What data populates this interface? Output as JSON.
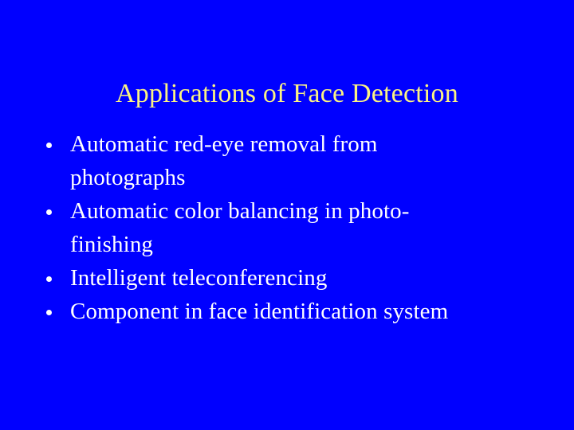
{
  "slide": {
    "background_color": "#0000FF",
    "title": {
      "text": "Applications of Face Detection",
      "color": "#FBF383"
    },
    "body": {
      "text_color": "#FFFFFF",
      "bullet_marker": "round-bullet",
      "items": [
        {
          "text": "Automatic red-eye removal from\nphotographs"
        },
        {
          "text": "Automatic color balancing in photo-\nfinishing"
        },
        {
          "text": "Intelligent teleconferencing"
        },
        {
          "text": "Component in face identification system"
        }
      ]
    }
  }
}
